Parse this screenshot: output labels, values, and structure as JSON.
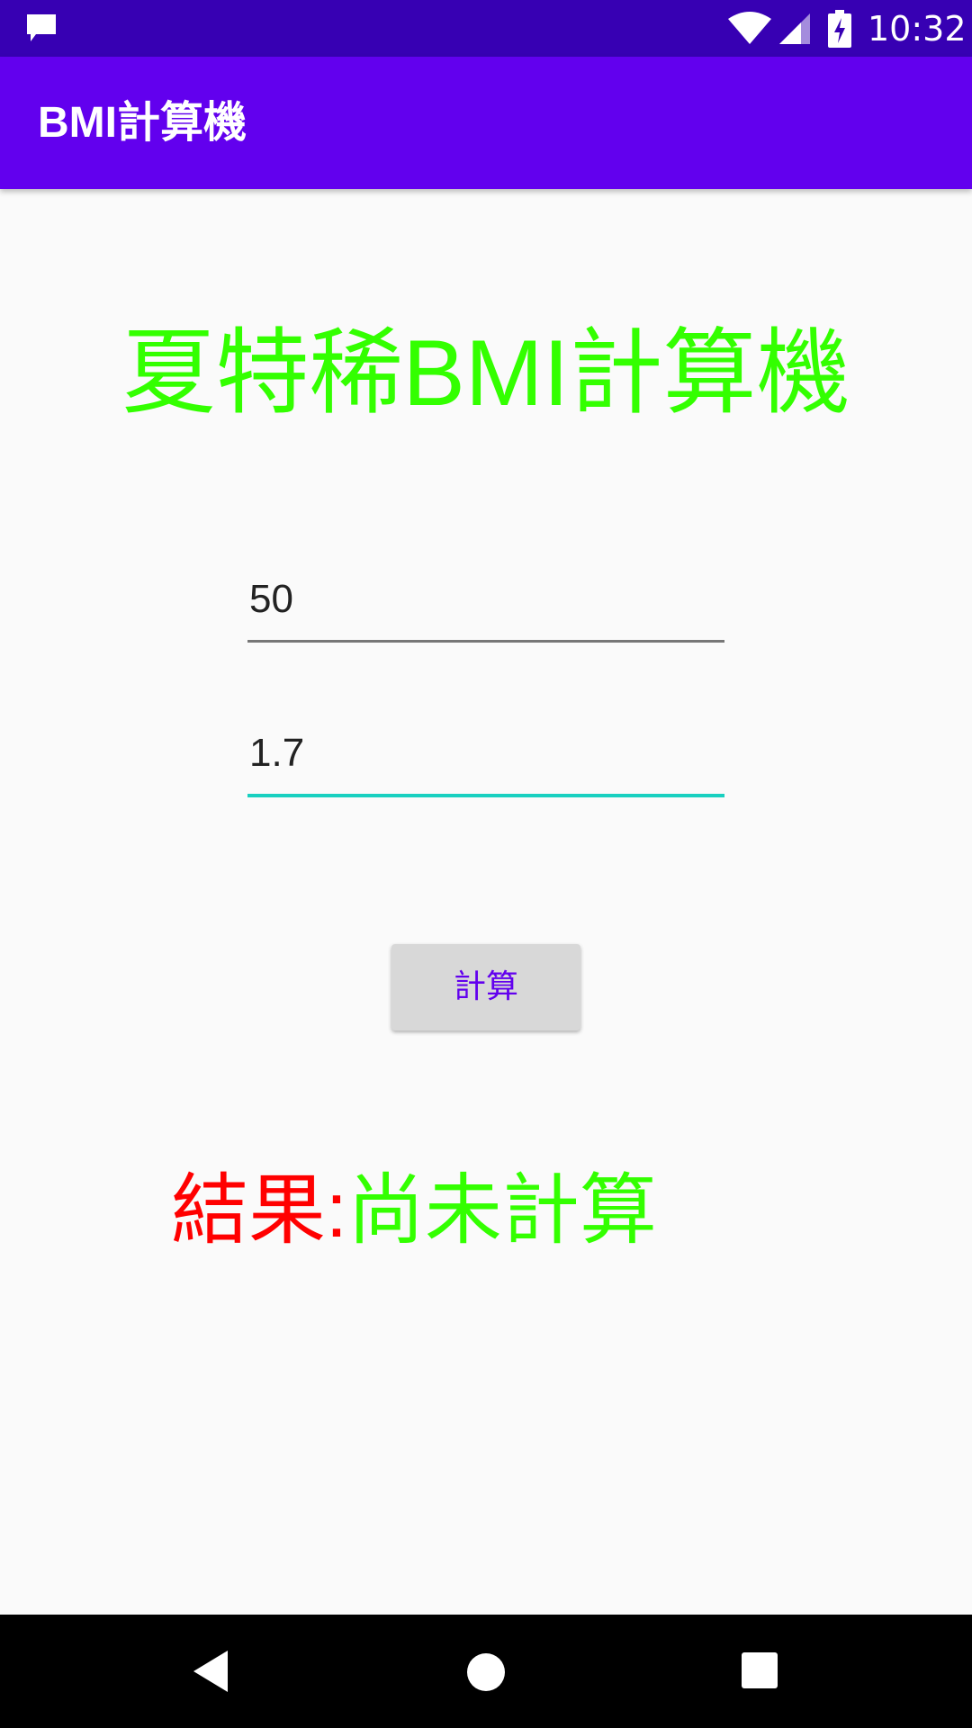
{
  "status_bar": {
    "time": "10:32",
    "icons": [
      "notification-icon",
      "wifi-icon",
      "signal-icon",
      "battery-charging-icon"
    ]
  },
  "app_bar": {
    "title": "BMI計算機"
  },
  "main": {
    "heading": "夏特稀BMI計算機",
    "weight_field": {
      "value": "50"
    },
    "height_field": {
      "value": "1.7"
    },
    "calculate_button": "計算",
    "result_label": "結果:",
    "result_value": "尚未計算"
  },
  "nav_bar": {
    "icons": [
      "back-icon",
      "home-icon",
      "recents-icon"
    ]
  },
  "colors": {
    "status_bar": "#3700b3",
    "app_bar": "#6200ee",
    "heading": "#33ff00",
    "result_label": "#ff0000",
    "result_value": "#33ff00",
    "focused_underline": "#18d0c0"
  }
}
